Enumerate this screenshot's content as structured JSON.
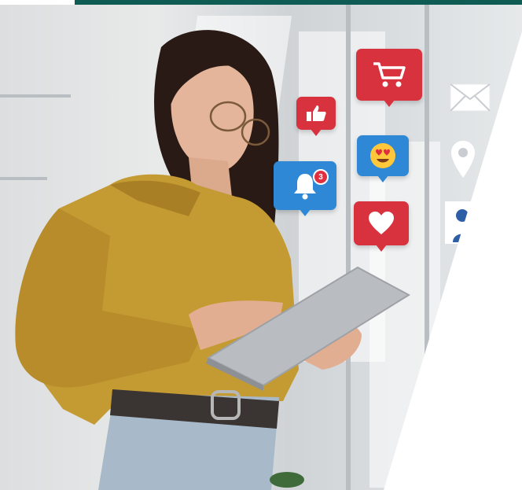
{
  "scene": {
    "subject": "woman-using-tablet",
    "colors": {
      "accent_bar": "#0e5c54",
      "shirt": "#c49a33",
      "hair": "#2a1a15",
      "tablet": "#b9bcc0",
      "jeans": "#a8b9c9",
      "icon_red": "#d8323f",
      "icon_blue": "#2e88d6"
    },
    "icons": {
      "shopping_cart": "shopping-cart-icon",
      "thumbs_up": "thumbs-up-icon",
      "emoji_love": "heart-eyes-emoji-icon",
      "notification_bell": "bell-icon",
      "heart": "heart-icon",
      "mail": "mail-icon",
      "location": "location-pin-icon",
      "person": "person-icon"
    },
    "notification_count": "3"
  }
}
